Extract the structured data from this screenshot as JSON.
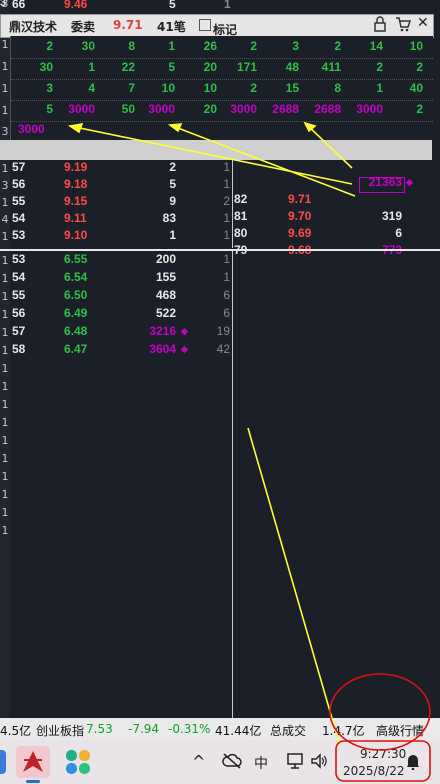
{
  "top_row": {
    "code": "66",
    "price": "9.46",
    "vol": "5",
    "n": "1"
  },
  "header": {
    "name": "鼎汉技术",
    "mode": "委卖",
    "price": "9.71",
    "count": "41笔",
    "mark_label": "标记",
    "lock_icon": "lock-icon",
    "cart_icon": "cart-icon",
    "close_icon": "close-icon"
  },
  "order_rows": [
    [
      "2",
      "30",
      "8",
      "1",
      "26",
      "2",
      "3",
      "2",
      "14",
      "10"
    ],
    [
      "30",
      "1",
      "22",
      "5",
      "20",
      "171",
      "48",
      "411",
      "2",
      "2"
    ],
    [
      "3",
      "4",
      "7",
      "10",
      "10",
      "2",
      "15",
      "8",
      "1",
      "40"
    ],
    [
      "5",
      "3000",
      "50",
      "3000",
      "20",
      "3000",
      "2688",
      "2688",
      "3000",
      "2"
    ]
  ],
  "extra_row": "3000",
  "left_rail_numbers": [
    "3",
    "1",
    "1",
    "1",
    "1",
    "3",
    "",
    "1",
    "3",
    "1",
    "4",
    "1"
  ],
  "sell_rows": [
    {
      "code": "57",
      "price": "9.19",
      "vol": "2",
      "n": "1"
    },
    {
      "code": "56",
      "price": "9.18",
      "vol": "5",
      "n": "1"
    },
    {
      "code": "55",
      "price": "9.15",
      "vol": "9",
      "n": "2"
    },
    {
      "code": "54",
      "price": "9.11",
      "vol": "83",
      "n": "1"
    },
    {
      "code": "53",
      "price": "9.10",
      "vol": "1",
      "n": "1"
    }
  ],
  "right_rows": [
    {
      "code": "",
      "price": "",
      "vol": "21363",
      "marker": "◆"
    },
    {
      "code": "82",
      "price": "9.71",
      "vol": "",
      "marker": ""
    },
    {
      "code": "81",
      "price": "9.70",
      "vol": "319",
      "marker": ""
    },
    {
      "code": "80",
      "price": "9.69",
      "vol": "6",
      "marker": ""
    },
    {
      "code": "79",
      "price": "9.68",
      "vol": "773",
      "marker": ""
    }
  ],
  "buy_rows": [
    {
      "code": "53",
      "price": "6.55",
      "vol": "200",
      "n": "1",
      "marker": ""
    },
    {
      "code": "54",
      "price": "6.54",
      "vol": "155",
      "n": "1",
      "marker": ""
    },
    {
      "code": "55",
      "price": "6.50",
      "vol": "468",
      "n": "6",
      "marker": ""
    },
    {
      "code": "56",
      "price": "6.49",
      "vol": "522",
      "n": "6",
      "marker": ""
    },
    {
      "code": "57",
      "price": "6.48",
      "vol": "3216",
      "n": "19",
      "marker": "◆"
    },
    {
      "code": "58",
      "price": "6.47",
      "vol": "3604",
      "n": "42",
      "marker": "◆"
    }
  ],
  "status_bar": {
    "left_value": "4.5亿",
    "index_name": "创业板指",
    "index_value": "7.53",
    "change": "-7.94",
    "change_pct": "-0.31%",
    "amount": "41.44亿",
    "total_label": "总成交",
    "total_value": "1.4.7亿",
    "advanced_label": "高级行情"
  },
  "taskbar": {
    "time": "9:27:30",
    "date": "2025/8/22",
    "ime": "中",
    "caret": "^"
  },
  "colors": {
    "bg": "#1b1f27",
    "green": "#2fbf47",
    "red": "#ff4a4a",
    "purple": "#c400c4",
    "annotation": "#ffff33",
    "circle": "#e01010"
  }
}
